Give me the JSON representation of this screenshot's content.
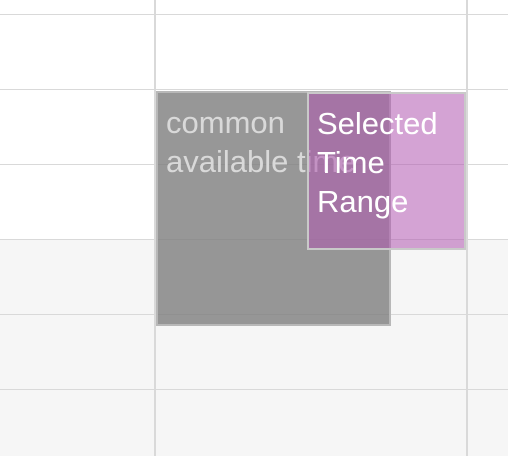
{
  "calendar": {
    "events": {
      "common": {
        "label": "common available time"
      },
      "selected": {
        "label": "Selected Time Range"
      }
    }
  },
  "colors": {
    "grid_line": "#d9d9d9",
    "shaded_background": "#f6f6f6",
    "common_block": "#808080",
    "selected_block": "#b158b1"
  }
}
